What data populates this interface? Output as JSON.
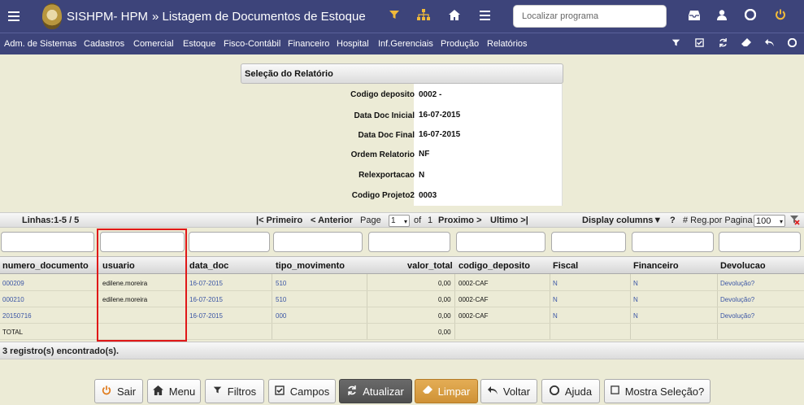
{
  "header": {
    "brand": "SISHPM- HPM",
    "page_title": "» Listagem de Documentos de Estoque",
    "search_placeholder": "Localizar programa"
  },
  "menu": [
    "Adm. de Sistemas",
    "Cadastros",
    "Comercial",
    "Estoque",
    "Fisco-Contábil",
    "Financeiro",
    "Hospital",
    "Inf.Gerenciais",
    "Produção",
    "Relatórios"
  ],
  "selection": {
    "title": "Seleção do Relatório",
    "params": [
      {
        "label": "Codigo deposito",
        "value": "0002 -"
      },
      {
        "label": "Data Doc Inicial",
        "value": "16-07-2015"
      },
      {
        "label": "Data Doc Final",
        "value": "16-07-2015"
      },
      {
        "label": "Ordem Relatorio",
        "value": "NF"
      },
      {
        "label": "Relexportacao",
        "value": "N"
      },
      {
        "label": "Codigo Projeto2",
        "value": "0003"
      }
    ]
  },
  "pagination": {
    "lines": "Linhas:1-5 / 5",
    "first": "|< Primeiro",
    "prev": "< Anterior",
    "page_label": "Page",
    "page_value": "1",
    "of_label": "of",
    "total_pages": "1",
    "next": "Proximo >",
    "last": "Ultimo >|",
    "display_columns": "Display columns▼",
    "help": "?",
    "per_page_label": "# Reg.por Pagina",
    "per_page_value": "100"
  },
  "table": {
    "columns": [
      "numero_documento",
      "usuario",
      "data_doc",
      "tipo_movimento",
      "valor_total",
      "codigo_deposito",
      "Fiscal",
      "Financeiro",
      "Devolucao"
    ],
    "rows": [
      [
        "000209",
        "edilene.moreira",
        "16-07-2015",
        "510",
        "0,00",
        "0002-CAF",
        "N",
        "N",
        "Devolução?"
      ],
      [
        "000210",
        "edilene.moreira",
        "16-07-2015",
        "510",
        "0,00",
        "0002-CAF",
        "N",
        "N",
        "Devolução?"
      ],
      [
        "20150716",
        "",
        "16-07-2015",
        "000",
        "0,00",
        "0002-CAF",
        "N",
        "N",
        "Devolução?"
      ]
    ],
    "total_label": "TOTAL",
    "total_value": "0,00",
    "count_text": "3 registro(s) encontrado(s)."
  },
  "buttons": {
    "sair": "Sair",
    "menu": "Menu",
    "filtros": "Filtros",
    "campos": "Campos",
    "atualizar": "Atualizar",
    "limpar": "Limpar",
    "voltar": "Voltar",
    "ajuda": "Ajuda",
    "mostra_selecao": "Mostra Seleção?"
  },
  "colors": {
    "header_bg": "#3d447a",
    "page_bg": "#ecebd6",
    "link_blue": "#3a55a5",
    "highlight_red": "#e01818",
    "atualizar_bg": "#555555",
    "limpar_bg": "#d89a3e",
    "sair_icon": "#e07a1a"
  }
}
